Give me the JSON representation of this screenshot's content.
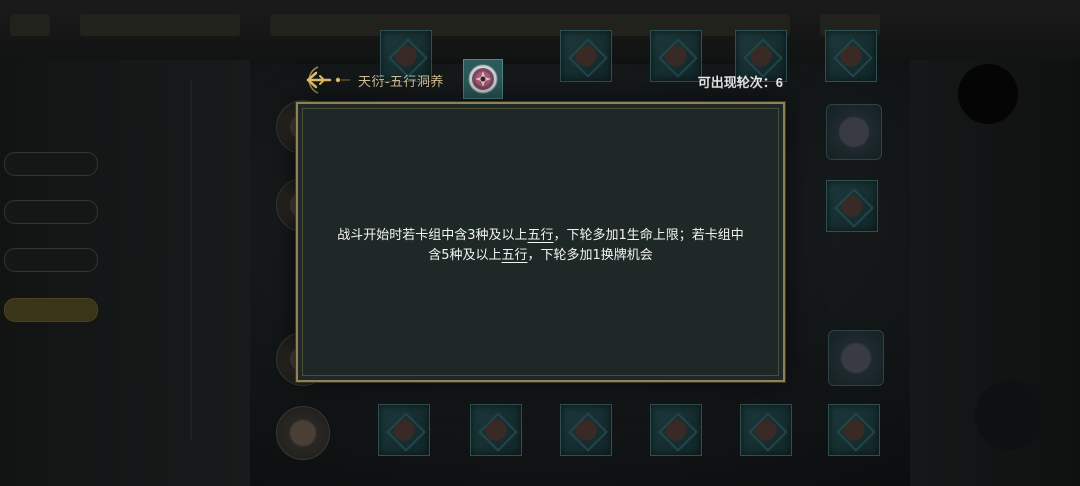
{
  "header": {
    "back_icon": "arrow-back-icon",
    "title": "天衍-五行洞养",
    "medal_icon": "wuxing-medal-icon",
    "rounds_label": "可出现轮次：",
    "rounds_value": "6"
  },
  "dialog": {
    "line1_a": "战斗开始时若卡组中含3种及以上",
    "line1_kw": "五行",
    "line1_b": "，下轮多加1生命上限；若卡组中",
    "line2_a": "含5种及以上",
    "line2_kw": "五行",
    "line2_b": "，下轮多加1换牌机会"
  },
  "colors": {
    "dialog_bg": "#1e2826",
    "dialog_border": "#8f8257",
    "title_gold": "#d8c79a",
    "medal_teal": "#2d5b5b"
  }
}
